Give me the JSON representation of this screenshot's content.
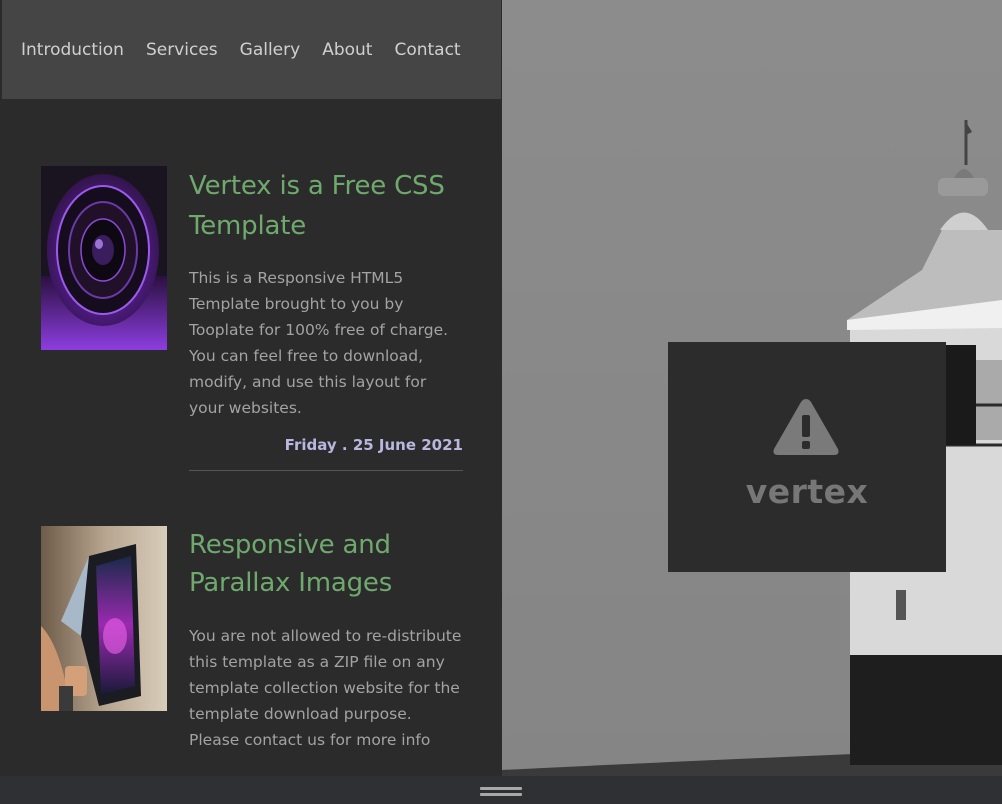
{
  "nav": {
    "items": [
      "Introduction",
      "Services",
      "Gallery",
      "About",
      "Contact"
    ]
  },
  "articles": [
    {
      "title": "Vertex is a Free CSS Template",
      "body": "This is a Responsive HTML5 Template brought to you by Tooplate for 100% free of charge. You can feel free to download, modify, and use this layout for your websites.",
      "date": "Friday . 25 June 2021",
      "image": "camera-lens-photo"
    },
    {
      "title": "Responsive and Parallax Images",
      "body": "You are not allowed to re-distribute this template as a ZIP file on any template collection website for the template download purpose. Please contact us for more info",
      "image": "foldable-phone-photo"
    }
  ],
  "hero": {
    "logo_text": "vertex",
    "logo_icon": "warning-icon",
    "image": "lighthouse-photo"
  },
  "colors": {
    "title": "#6fa96d",
    "date": "#b9b6df",
    "nav_bg": "#454545",
    "panel_bg": "#2b2b2b"
  }
}
